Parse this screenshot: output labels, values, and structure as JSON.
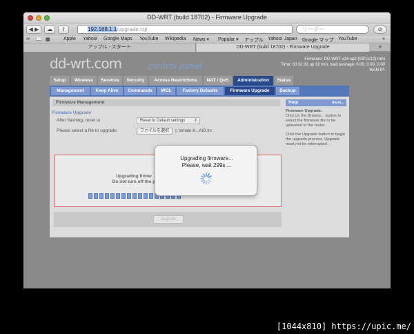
{
  "window": {
    "title": "DD-WRT (build 18702) - Firmware Upgrade"
  },
  "toolbar": {
    "address_host": "192.168.1.1",
    "address_path": "/upgrade.cgi",
    "search_placeholder": "リーダー"
  },
  "bookmarks": [
    "Apple",
    "Yahoo!",
    "Google Maps",
    "YouTube",
    "Wikipedia",
    "News ▾",
    "Popular ▾",
    "アップル",
    "Yahoo! Japan",
    "Google マップ",
    "YouTube",
    "»"
  ],
  "tabs": [
    {
      "label": "アップル - スタート",
      "active": false
    },
    {
      "label": "DD-WRT (build 18702) - Firmware Upgrade",
      "active": true
    }
  ],
  "header": {
    "logo": "dd-wrt.com",
    "logo_sub": "control panel",
    "firmware": "Firmware: DD-WRT v24-sp2 (03/11/12) mini",
    "time": "Time: 00:32:31 up 32 min, load average: 0.00, 0.00, 0.00",
    "wan_ip": "WAN IP:"
  },
  "main_tabs": [
    {
      "label": "Setup",
      "active": false
    },
    {
      "label": "Wireless",
      "active": false
    },
    {
      "label": "Services",
      "active": false
    },
    {
      "label": "Security",
      "active": false
    },
    {
      "label": "Access Restrictions",
      "active": false
    },
    {
      "label": "NAT / QoS",
      "active": false
    },
    {
      "label": "Administration",
      "active": true
    },
    {
      "label": "Status",
      "active": false
    }
  ],
  "sub_tabs": [
    {
      "label": "Management",
      "active": false
    },
    {
      "label": "Keep Alive",
      "active": false
    },
    {
      "label": "Commands",
      "active": false
    },
    {
      "label": "WOL",
      "active": false
    },
    {
      "label": "Factory Defaults",
      "active": false
    },
    {
      "label": "Firmware Upgrade",
      "active": true
    },
    {
      "label": "Backup",
      "active": false
    }
  ],
  "content": {
    "section_title": "Firmware Management",
    "legend": "Firmware Upgrade",
    "reset_label": "After flashing, reset to",
    "reset_value": "Reset to Default settings",
    "file_label": "Please select a file to upgrade",
    "file_button": "ファイルを選択",
    "file_name": "tomato-K...AIO.trx",
    "progress_line1": "Upgrading firmw",
    "progress_line2": "Do not turn off the p",
    "progress_partial_w": "W",
    "progress_segments": 17,
    "upgrade_button": "Upgrade"
  },
  "help": {
    "title": "Help",
    "more": "more...",
    "heading": "Firmware Upgrade:",
    "p1": "Click on the Browse... button to select the firmware file to be uploaded to the router.",
    "p2": "Click the Upgrade button to begin the upgrade process. Upgrade must not be interrupted."
  },
  "modal": {
    "line1": "Upgrading firmware...",
    "line2": "Please, wait 299s ..."
  },
  "watermark": "[1044x810] https://upic.me/",
  "colors": {
    "active_tab": "#2b4a8b",
    "sub_bar": "#5377b8",
    "progress": "#7d9dd6"
  }
}
